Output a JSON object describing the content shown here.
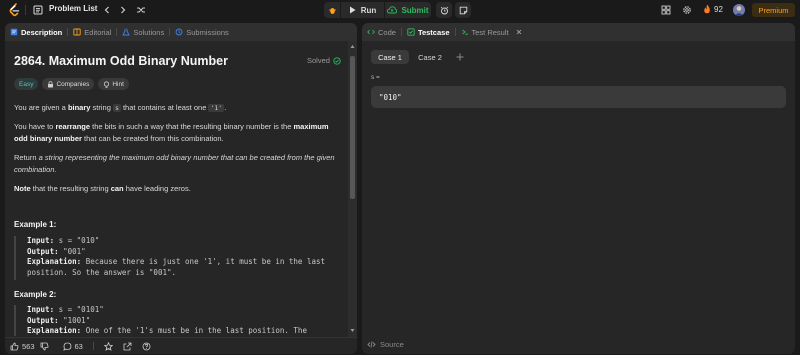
{
  "nav": {
    "problem_list": "Problem List",
    "run": "Run",
    "submit": "Submit",
    "streak_count": "92",
    "premium": "Premium"
  },
  "left_tabs": [
    {
      "label": "Description",
      "active": true
    },
    {
      "label": "Editorial",
      "active": false
    },
    {
      "label": "Solutions",
      "active": false
    },
    {
      "label": "Submissions",
      "active": false
    }
  ],
  "problem": {
    "title": "2864. Maximum Odd Binary Number",
    "status": "Solved",
    "difficulty": "Easy",
    "companies": "Companies",
    "hint": "Hint",
    "p1_a": "You are given a ",
    "p1_b": "binary",
    "p1_c": " string ",
    "p1_code1": "s",
    "p1_d": " that contains at least one ",
    "p1_code2": "'1'",
    "p1_e": ".",
    "p2_a": "You have to ",
    "p2_b": "rearrange",
    "p2_c": " the bits in such a way that the resulting binary number is the ",
    "p2_d": "maximum odd binary number",
    "p2_e": " that can be created from this combination.",
    "p3_a": "Return ",
    "p3_b": "a string representing the maximum odd binary number that can be created from the given combination.",
    "p4_a": "Note",
    "p4_b": " that the resulting string ",
    "p4_c": "can",
    "p4_d": " have leading zeros."
  },
  "examples": [
    {
      "title": "Example 1:",
      "input_label": "Input:",
      "input": " s = \"010\"",
      "output_label": "Output:",
      "output": " \"001\"",
      "expl_label": "Explanation:",
      "expl_line1": " Because there is just one '1', it must be in the last",
      "expl_line2": "position. So the answer is \"001\"."
    },
    {
      "title": "Example 2:",
      "input_label": "Input:",
      "input": " s = \"0101\"",
      "output_label": "Output:",
      "output": " \"1001\"",
      "expl_label": "Explanation:",
      "expl_line1": " One of the '1's must be in the last position. The"
    }
  ],
  "footer": {
    "likes": "563",
    "comments": "63"
  },
  "right_tabs": [
    {
      "label": "Code",
      "active": false
    },
    {
      "label": "Testcase",
      "active": true
    },
    {
      "label": "Test Result",
      "active": false
    }
  ],
  "testcase": {
    "cases": [
      "Case 1",
      "Case 2"
    ],
    "var_name": "s =",
    "var_value": "\"010\""
  },
  "source_label": "Source",
  "colors": {
    "accent_orange": "#ffa116",
    "green": "#2cbb5d",
    "easy": "#46c6c2",
    "panel": "#262626",
    "background": "#1a1a1a"
  }
}
